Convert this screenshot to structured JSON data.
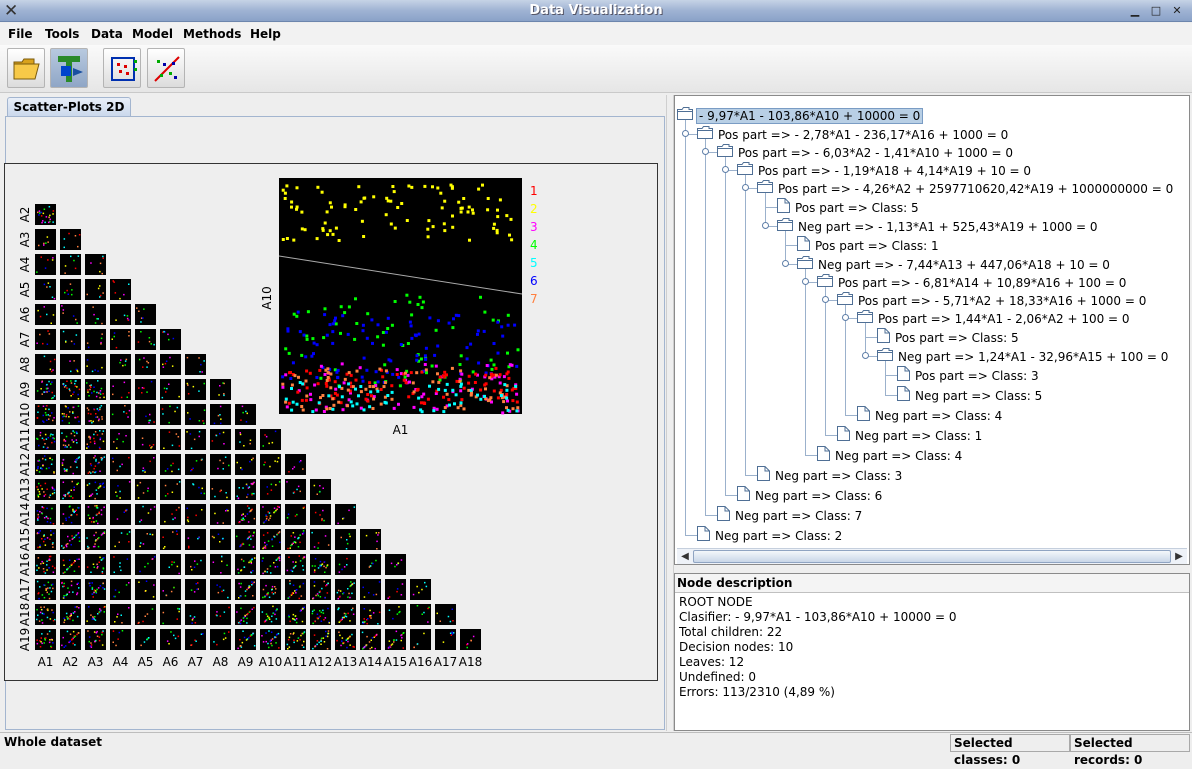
{
  "window": {
    "title": "Data Visualization"
  },
  "menu": [
    "File",
    "Tools",
    "Data",
    "Model",
    "Methods",
    "Help"
  ],
  "toolbar": {
    "buttons": [
      "open-folder",
      "tree-model",
      "scatter-matrix",
      "scatter-diagonal"
    ]
  },
  "tabs": [
    "Scatter-Plots 2D"
  ],
  "scatter": {
    "row_labels": [
      "A2",
      "A3",
      "A4",
      "A5",
      "A6",
      "A7",
      "A8",
      "A9",
      "A10",
      "A11",
      "A12",
      "A13",
      "A14",
      "A15",
      "A16",
      "A17",
      "A18",
      "A19"
    ],
    "col_labels": [
      "A1",
      "A2",
      "A3",
      "A4",
      "A5",
      "A6",
      "A7",
      "A8",
      "A9",
      "A10",
      "A11",
      "A12",
      "A13",
      "A14",
      "A15",
      "A16",
      "A17",
      "A18"
    ],
    "zoom": {
      "xlabel": "A1",
      "ylabel": "A10"
    },
    "legend": [
      {
        "label": "1",
        "color": "#ff0000"
      },
      {
        "label": "2",
        "color": "#ffff00"
      },
      {
        "label": "3",
        "color": "#ff00ff"
      },
      {
        "label": "4",
        "color": "#00ff00"
      },
      {
        "label": "5",
        "color": "#00ffff"
      },
      {
        "label": "6",
        "color": "#0000ff"
      },
      {
        "label": "7",
        "color": "#ff8040"
      }
    ]
  },
  "tree": {
    "nodes": [
      {
        "label": "- 9,97*A1 - 103,86*A10 + 10000 = 0",
        "type": "folder"
      },
      {
        "label": "Pos part => - 2,78*A1 - 236,17*A16 + 1000 = 0",
        "type": "folder"
      },
      {
        "label": "Pos part => - 6,03*A2 - 1,41*A10 + 1000 = 0",
        "type": "folder"
      },
      {
        "label": "Pos part => - 1,19*A18 + 4,14*A19 + 10 = 0",
        "type": "folder"
      },
      {
        "label": "Pos part => - 4,26*A2 + 2597710620,42*A19 + 1000000000 = 0",
        "type": "folder"
      },
      {
        "label": "Pos part => Class: 5",
        "type": "leaf"
      },
      {
        "label": "Neg part  => - 1,13*A1 + 525,43*A19 + 1000 = 0",
        "type": "folder"
      },
      {
        "label": "Pos part => Class: 1",
        "type": "leaf"
      },
      {
        "label": "Neg part  => - 7,44*A13 + 447,06*A18 + 10 = 0",
        "type": "folder"
      },
      {
        "label": "Pos part => - 6,81*A14 + 10,89*A16 + 100 = 0",
        "type": "folder"
      },
      {
        "label": "Pos part => - 5,71*A2 + 18,33*A16 + 1000 = 0",
        "type": "folder"
      },
      {
        "label": "Pos part => 1,44*A1 - 2,06*A2 + 100 = 0",
        "type": "folder"
      },
      {
        "label": "Pos part => Class: 5",
        "type": "leaf"
      },
      {
        "label": "Neg part  => 1,24*A1 - 32,96*A15 + 100 = 0",
        "type": "folder"
      },
      {
        "label": "Pos part => Class: 3",
        "type": "leaf"
      },
      {
        "label": "Neg part  => Class: 5",
        "type": "leaf"
      },
      {
        "label": "Neg part  => Class: 4",
        "type": "leaf"
      },
      {
        "label": "Neg part  => Class: 1",
        "type": "leaf"
      },
      {
        "label": "Neg part  => Class: 4",
        "type": "leaf"
      },
      {
        "label": "Neg part  => Class: 3",
        "type": "leaf"
      },
      {
        "label": "Neg part  => Class: 6",
        "type": "leaf"
      },
      {
        "label": "Neg part  => Class: 7",
        "type": "leaf"
      },
      {
        "label": "Neg part  => Class: 2",
        "type": "leaf"
      }
    ]
  },
  "description": {
    "header": "Node description",
    "lines": [
      "ROOT NODE",
      "Clasifier: - 9,97*A1 - 103,86*A10 + 10000 = 0",
      "Total children: 22",
      "Decision nodes: 10",
      "Leaves: 12",
      "Undefined: 0",
      "Errors: 113/2310 (4,89 %)"
    ]
  },
  "status": {
    "left": "Whole dataset",
    "classes": "Selected classes: 0",
    "records": "Selected records: 0"
  }
}
